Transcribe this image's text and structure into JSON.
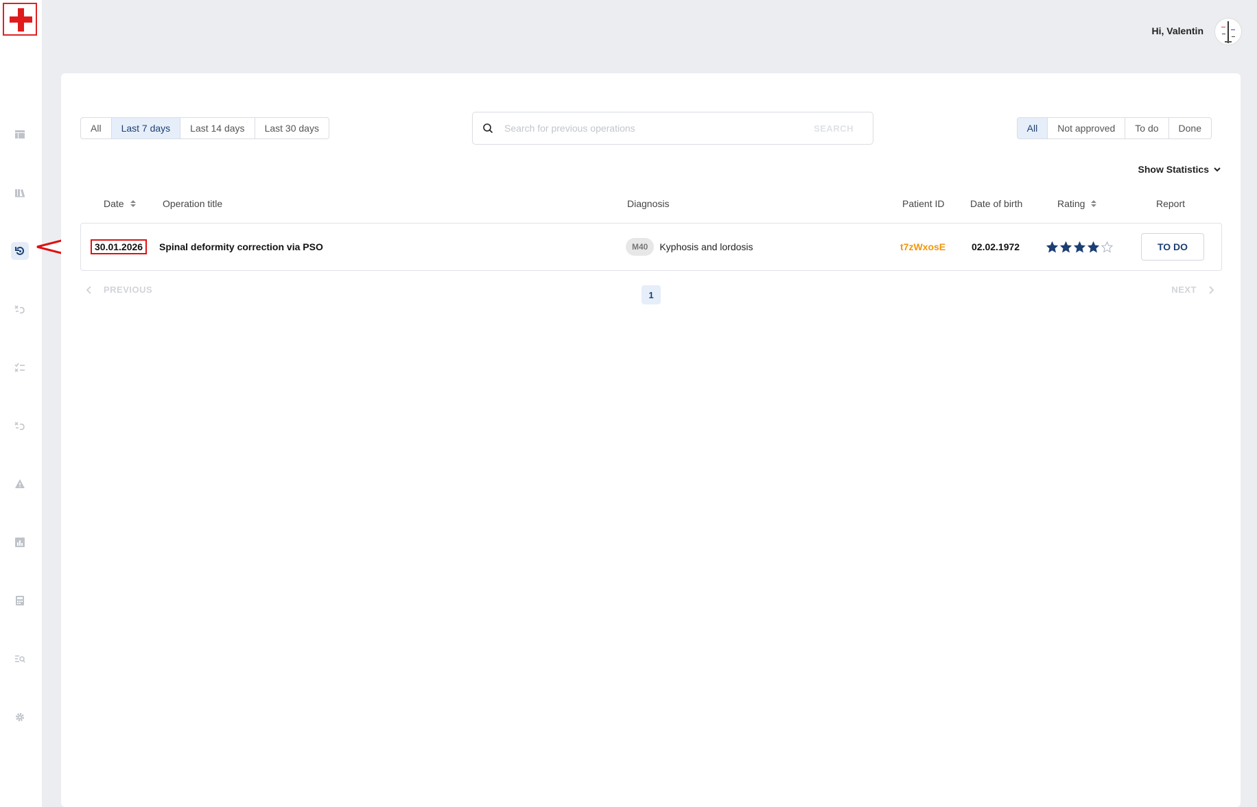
{
  "header": {
    "greeting": "Hi, Valentin"
  },
  "sidebar": {
    "items": [
      {
        "name": "dashboard-icon"
      },
      {
        "name": "library-icon"
      },
      {
        "name": "history-icon",
        "active": true
      },
      {
        "name": "rejected-history-icon"
      },
      {
        "name": "checklist-icon"
      },
      {
        "name": "rejected-history-icon"
      },
      {
        "name": "warning-icon"
      },
      {
        "name": "bar-chart-icon"
      },
      {
        "name": "calculator-icon"
      },
      {
        "name": "list-search-icon"
      },
      {
        "name": "gear-icon"
      }
    ]
  },
  "filters": {
    "period": [
      "All",
      "Last 7 days",
      "Last 14 days",
      "Last 30 days"
    ],
    "period_selected": "Last 7 days",
    "status": [
      "All",
      "Not approved",
      "To do",
      "Done"
    ],
    "status_selected": "All"
  },
  "search": {
    "placeholder": "Search for previous operations",
    "value": "",
    "button_label": "SEARCH"
  },
  "statistics_toggle": "Show Statistics",
  "table": {
    "headers": {
      "date": "Date",
      "operation_title": "Operation title",
      "diagnosis": "Diagnosis",
      "patient_id": "Patient ID",
      "date_of_birth": "Date of birth",
      "rating": "Rating",
      "report": "Report"
    },
    "rows": [
      {
        "date": "30.01.2026",
        "operation_title": "Spinal deformity correction via PSO",
        "diagnosis_code": "M40",
        "diagnosis": "Kyphosis and lordosis",
        "patient_id": "t7zWxosE",
        "date_of_birth": "02.02.1972",
        "rating": 4,
        "rating_max": 5,
        "report": "TO DO"
      }
    ]
  },
  "pagination": {
    "previous": "PREVIOUS",
    "current": "1",
    "next": "NEXT"
  },
  "colors": {
    "accent": "#1c3f73",
    "patient_id": "#f0960d",
    "star": "#1c3f73",
    "annotation": "#dd1111"
  }
}
